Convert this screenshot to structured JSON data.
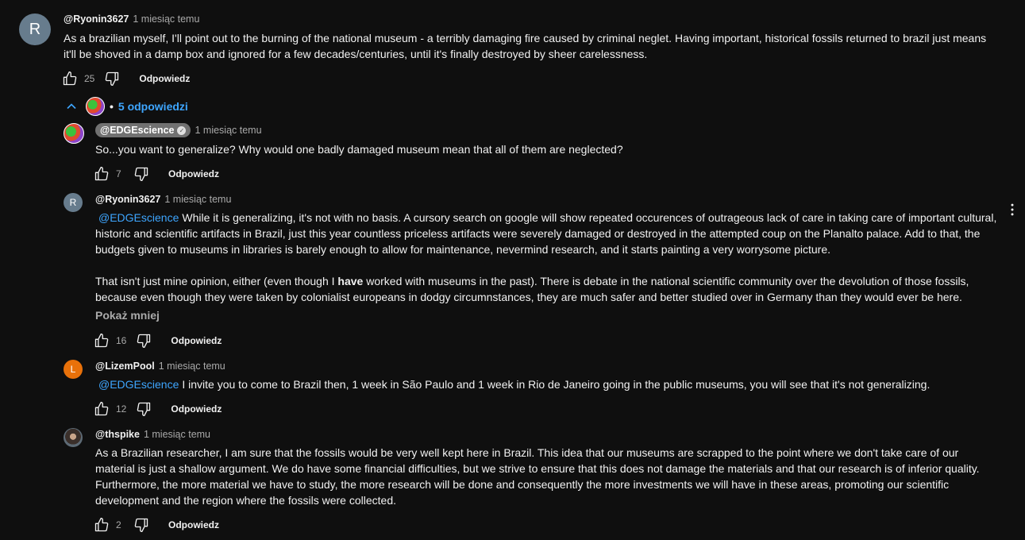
{
  "comment": {
    "avatar_letter": "R",
    "avatar_color": "#677c8d",
    "author": "@Ryonin3627",
    "time": "1 miesiąc temu",
    "text": "As a brazilian myself, I'll point out to the burning of the national museum - a terribly damaging fire caused by criminal neglet. Having important, historical fossils returned to brazil just means it'll be shoved in a damp box and ignored for a few decades/centuries, until it's finally destroyed by sheer carelessness.",
    "likes": "25",
    "reply_label": "Odpowiedz"
  },
  "replies_toggle": {
    "label": "5 odpowiedzi",
    "icon": "chevron-up-icon"
  },
  "replies": [
    {
      "author": "@EDGEscience",
      "verified": true,
      "time": "1 miesiąc temu",
      "text": "So...you want to generalize? Why would one badly damaged museum mean that all of them are neglected?",
      "likes": "7",
      "reply_label": "Odpowiedz"
    },
    {
      "avatar_letter": "R",
      "avatar_color": "#677c8d",
      "author": "@Ryonin3627",
      "time": "1 miesiąc temu",
      "mention": "@EDGEscience",
      "text_p1_a": "While it is generalizing, it's not with no basis. A cursory search on google will show repeated occurences of outrageous lack of care in taking care of important cultural, historic and scientific artifacts in Brazil, just this year countless priceless artifacts were severely damaged or destroyed in the attempted coup on the Planalto palace. Add to that, the budgets given to museums in libraries is barely enough to allow for maintenance, nevermind research, and it starts painting a very worrysome picture.",
      "text_p2_a": "That isn't just mine opinion, either (even though I ",
      "text_p2_bold": "have",
      "text_p2_b": " worked with museums in the past). There is debate in the national scientific community over the devolution of those fossils, because even though they were taken by colonialist europeans in dodgy circumnstances, they are much safer and better studied over in Germany than they would ever be here.",
      "show_less": "Pokaż mniej",
      "likes": "16",
      "reply_label": "Odpowiedz"
    },
    {
      "avatar_letter": "L",
      "avatar_color": "#e8710a",
      "author": "@LizemPool",
      "time": "1 miesiąc temu",
      "mention": "@EDGEscience",
      "text": "I invite you to come to Brazil then, 1 week in São Paulo and 1 week in Rio de Janeiro going in the public museums, you will see that it's not generalizing.",
      "likes": "12",
      "reply_label": "Odpowiedz"
    },
    {
      "author": "@thspike",
      "time": "1 miesiąc temu",
      "text": "As a Brazilian researcher, I am sure that the fossils would be very well kept here in Brazil. This idea that our museums are scrapped to the point where we don't take care of our material is just a shallow argument. We do have some financial difficulties, but we strive to ensure that this does not damage the materials and that our research is of inferior quality. Furthermore, the more material we have to study, the more research will be done and consequently the more investments we will have in these areas, promoting our scientific development and the region where the fossils were collected.",
      "likes": "2",
      "reply_label": "Odpowiedz"
    }
  ],
  "colors": {
    "background": "#0f0f0f",
    "text": "#f1f1f1",
    "secondary": "#aaaaaa",
    "link": "#3ea6ff"
  }
}
